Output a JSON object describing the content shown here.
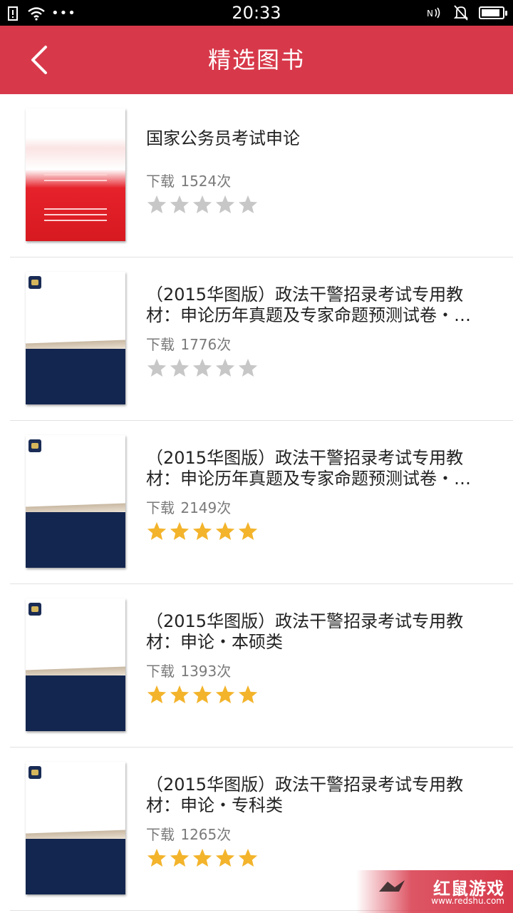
{
  "status_bar": {
    "time": "20:33",
    "left_icons": [
      "alert-icon",
      "wifi-icon",
      "more-dots-icon"
    ],
    "right_icons": [
      "nfc-icon",
      "silent-bell-icon",
      "battery-icon"
    ],
    "battery_level": 0.9
  },
  "app_bar": {
    "title": "精选图书",
    "back_icon": "chevron-left-icon",
    "color": "#d7394a"
  },
  "books": [
    {
      "title": "国家公务员考试申论",
      "downloads_label": "下载",
      "downloads": "1524次",
      "rating": 0,
      "cover": "red"
    },
    {
      "title": "（2015华图版）政法干警招录考试专用教材：申论历年真题及专家命题预测试卷・…",
      "downloads_label": "下载",
      "downloads": "1776次",
      "rating": 0,
      "cover": "navy"
    },
    {
      "title": "（2015华图版）政法干警招录考试专用教材：申论历年真题及专家命题预测试卷・…",
      "downloads_label": "下载",
      "downloads": "2149次",
      "rating": 5,
      "cover": "navy"
    },
    {
      "title": "（2015华图版）政法干警招录考试专用教材：申论・本硕类",
      "downloads_label": "下载",
      "downloads": "1393次",
      "rating": 5,
      "cover": "navy"
    },
    {
      "title": "（2015华图版）政法干警招录考试专用教材：申论・专科类",
      "downloads_label": "下载",
      "downloads": "1265次",
      "rating": 5,
      "cover": "navy"
    }
  ],
  "rating_max": 5,
  "star_colors": {
    "on": "#f3b42c",
    "off": "#c7c7c7"
  },
  "watermark": {
    "logo": "红鼠游戏",
    "url": "www.redshu.com"
  }
}
